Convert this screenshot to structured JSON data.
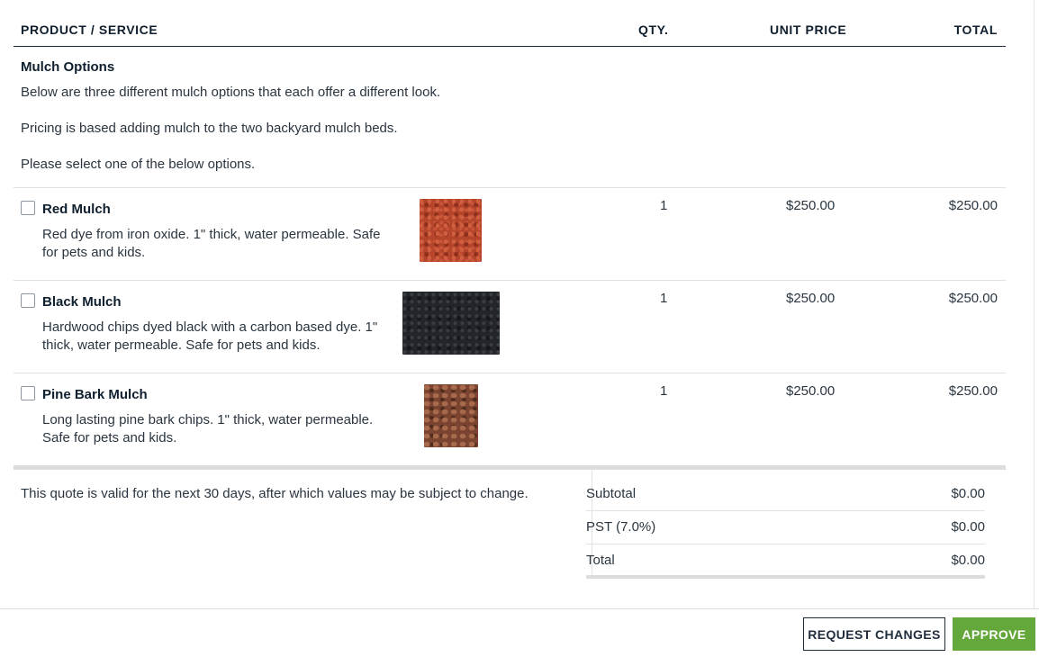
{
  "table_header": {
    "product": "PRODUCT / SERVICE",
    "qty": "QTY.",
    "unit_price": "UNIT PRICE",
    "total": "TOTAL"
  },
  "section": {
    "title": "Mulch Options",
    "lines": [
      "Below are three different mulch options that each offer a different look.",
      "Pricing is based adding mulch to the two backyard mulch beds.",
      "Please select one of the below options."
    ]
  },
  "items": [
    {
      "name": "Red Mulch",
      "description": "Red dye from iron oxide. 1\" thick, water permeable. Safe for pets and kids.",
      "qty": "1",
      "unit_price": "$250.00",
      "total": "$250.00",
      "checked": false,
      "swatch_color": "#b4442a"
    },
    {
      "name": "Black Mulch",
      "description": "Hardwood chips dyed black with a carbon based dye. 1\" thick, water permeable. Safe for pets and kids.",
      "qty": "1",
      "unit_price": "$250.00",
      "total": "$250.00",
      "checked": false,
      "swatch_color": "#22252a"
    },
    {
      "name": "Pine Bark Mulch",
      "description": "Long lasting pine bark chips. 1\" thick, water permeable. Safe for pets and kids.",
      "qty": "1",
      "unit_price": "$250.00",
      "total": "$250.00",
      "checked": false,
      "swatch_color": "#7a4430"
    }
  ],
  "footer_note": "This quote is valid for the next 30 days, after which values may be subject to change.",
  "summary": [
    {
      "label": "Subtotal",
      "value": "$0.00"
    },
    {
      "label": "PST (7.0%)",
      "value": "$0.00"
    },
    {
      "label": "Total",
      "value": "$0.00"
    }
  ],
  "actions": {
    "request_changes": "REQUEST CHANGES",
    "approve": "APPROVE"
  },
  "colors": {
    "approve_button": "#64a73a",
    "text_dark": "#0f1f2e"
  }
}
